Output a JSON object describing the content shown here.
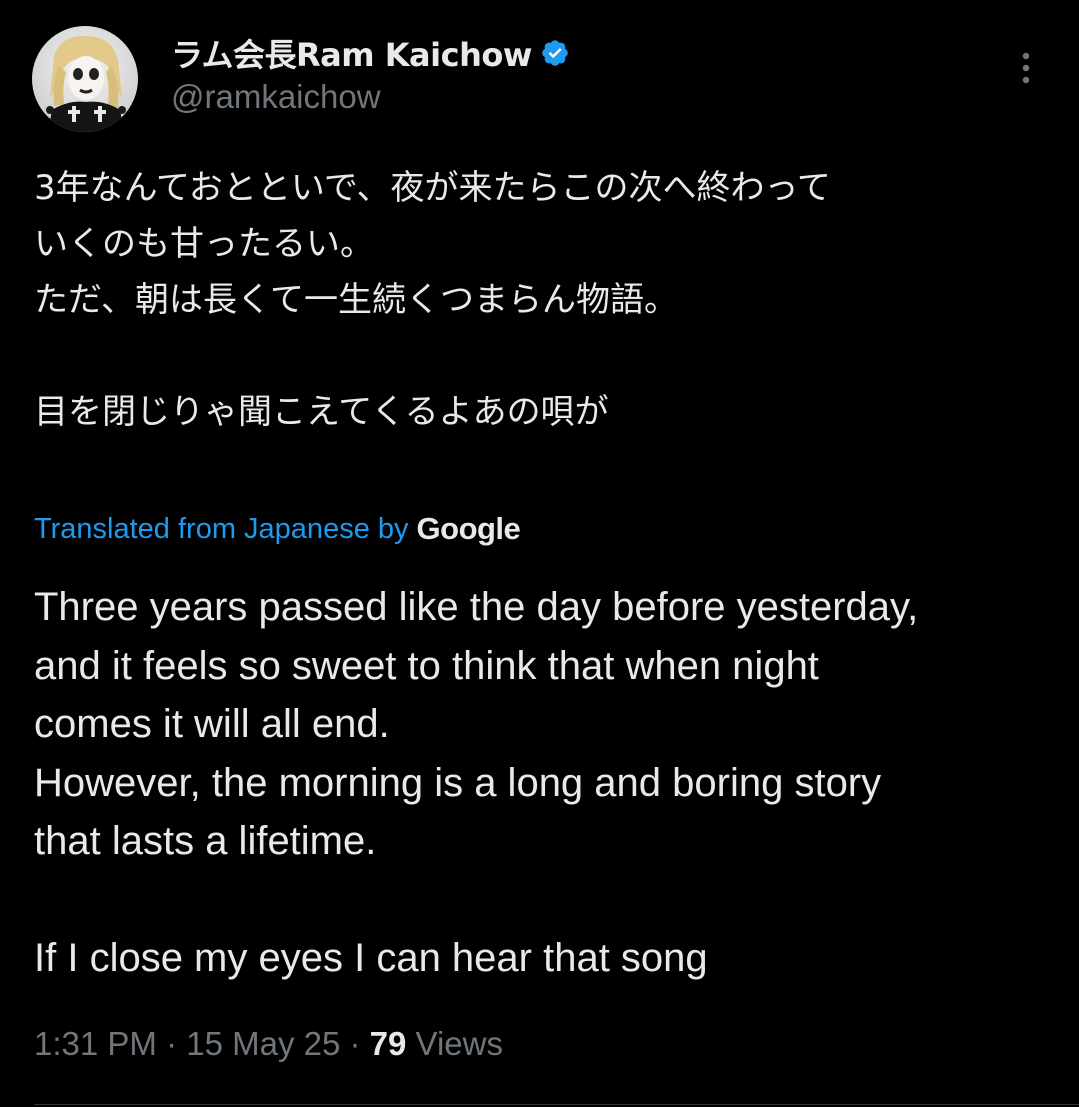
{
  "author": {
    "display_name": "ラム会長Ram Kaichow",
    "handle": "@ramkaichow",
    "verified_icon": "verified-badge-icon",
    "avatar_icon": "avatar"
  },
  "menu": {
    "icon": "more-options-icon"
  },
  "tweet": {
    "original_lines": [
      "3年なんておとといで、夜が来たらこの次へ終わって",
      "いくのも甘ったるい。",
      "ただ、朝は長くて一生続くつまらん物語。",
      "",
      "目を閉じりゃ聞こえてくるよあの唄が"
    ],
    "translation": {
      "label": "Translated from Japanese by",
      "provider": "Google",
      "lines": [
        "Three years passed like the day before yesterday,",
        "and it feels so sweet to think that when night",
        "comes it will all end.",
        "However, the morning is a long and boring story",
        "that lasts a lifetime.",
        "",
        "If I close my eyes I can hear that song"
      ]
    }
  },
  "meta": {
    "time": "1:31 PM",
    "separator": " · ",
    "date": "15 May 25",
    "views_count": "79",
    "views_label": " Views"
  },
  "colors": {
    "background": "#000000",
    "text": "#e7e9ea",
    "muted": "#71767b",
    "link": "#1d9bf0",
    "verified": "#1d9bf0"
  }
}
